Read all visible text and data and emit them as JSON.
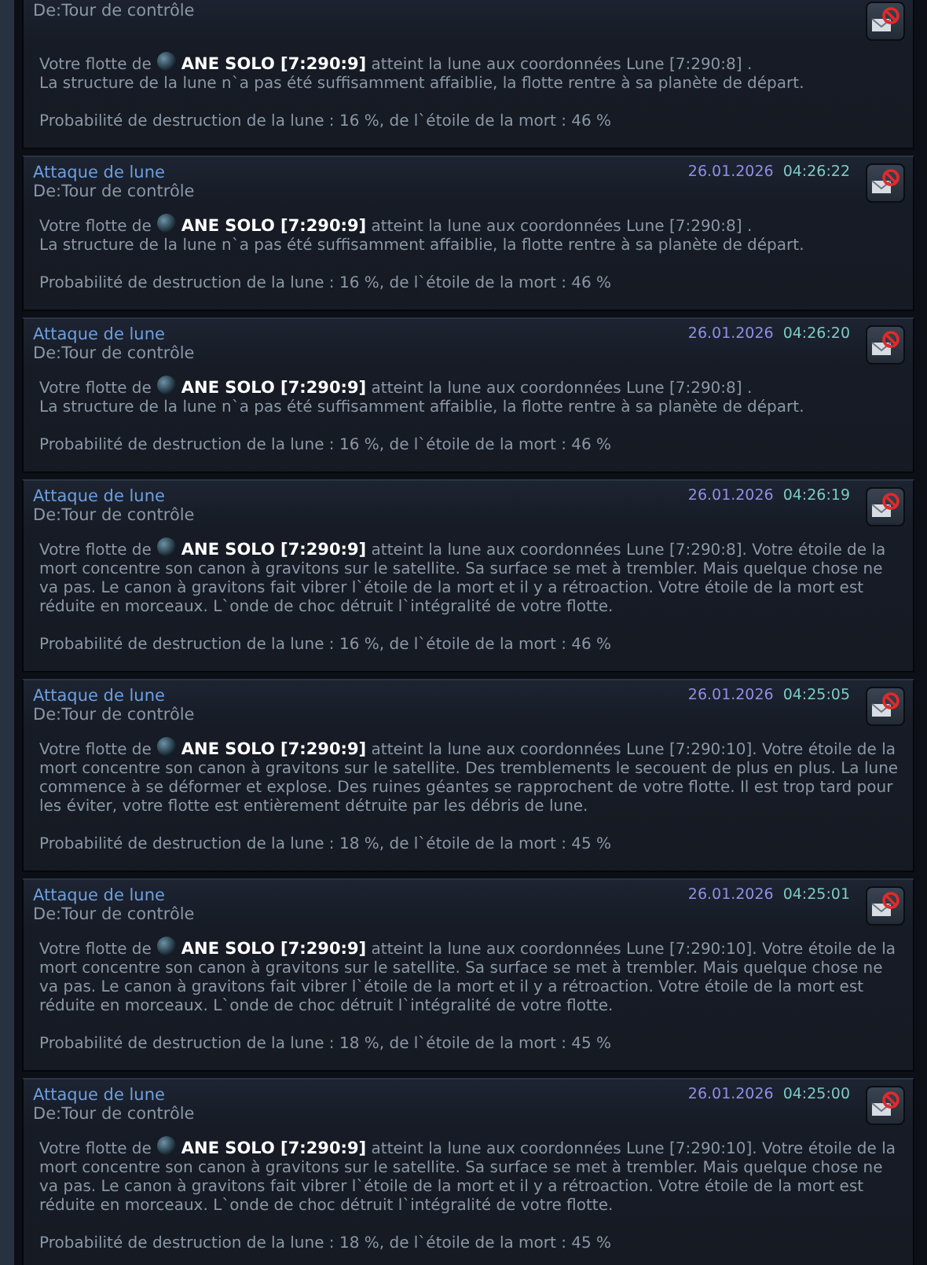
{
  "messages": [
    {
      "from": "De:Tour de contrôle",
      "fleet_prefix": "Votre flotte de",
      "player": "ANE SOLO [7:290:9]",
      "text": [
        "atteint la lune aux coordonnées Lune [7:290:8] .",
        "La structure de la lune n`a pas été suffisamment affaiblie, la flotte rentre à sa planète de départ."
      ],
      "probability": "Probabilité de destruction de la lune : 16 %, de l`étoile de la mort : 46 %"
    },
    {
      "title": "Attaque de lune",
      "from": "De:Tour de contrôle",
      "date": "26.01.2026",
      "time": "04:26:22",
      "fleet_prefix": "Votre flotte de",
      "player": "ANE SOLO [7:290:9]",
      "text": [
        "atteint la lune aux coordonnées Lune [7:290:8] .",
        "La structure de la lune n`a pas été suffisamment affaiblie, la flotte rentre à sa planète de départ."
      ],
      "probability": "Probabilité de destruction de la lune : 16 %, de l`étoile de la mort : 46 %"
    },
    {
      "title": "Attaque de lune",
      "from": "De:Tour de contrôle",
      "date": "26.01.2026",
      "time": "04:26:20",
      "fleet_prefix": "Votre flotte de",
      "player": "ANE SOLO [7:290:9]",
      "text": [
        "atteint la lune aux coordonnées Lune [7:290:8] .",
        "La structure de la lune n`a pas été suffisamment affaiblie, la flotte rentre à sa planète de départ."
      ],
      "probability": "Probabilité de destruction de la lune : 16 %, de l`étoile de la mort : 46 %"
    },
    {
      "title": "Attaque de lune",
      "from": "De:Tour de contrôle",
      "date": "26.01.2026",
      "time": "04:26:19",
      "fleet_prefix": "Votre flotte de",
      "player": "ANE SOLO [7:290:9]",
      "text": [
        "atteint la lune aux coordonnées Lune [7:290:8]. Votre étoile de la mort concentre son canon à gravitons sur le satellite. Sa surface se met à trembler. Mais quelque chose ne va pas. Le canon à gravitons fait vibrer l`étoile de la mort et il y a rétroaction. Votre étoile de la mort est réduite en morceaux. L`onde de choc détruit l`intégralité de votre flotte."
      ],
      "probability": "Probabilité de destruction de la lune : 16 %, de l`étoile de la mort : 46 %"
    },
    {
      "title": "Attaque de lune",
      "from": "De:Tour de contrôle",
      "date": "26.01.2026",
      "time": "04:25:05",
      "fleet_prefix": "Votre flotte de",
      "player": "ANE SOLO [7:290:9]",
      "text": [
        "atteint la lune aux coordonnées Lune [7:290:10]. Votre étoile de la mort concentre son canon à gravitons sur le satellite. Des tremblements le secouent de plus en plus. La lune commence à se déformer et explose. Des ruines géantes se rapprochent de votre flotte. Il est trop tard pour les éviter, votre flotte est entièrement détruite par les débris de lune."
      ],
      "probability": "Probabilité de destruction de la lune : 18 %, de l`étoile de la mort : 45 %"
    },
    {
      "title": "Attaque de lune",
      "from": "De:Tour de contrôle",
      "date": "26.01.2026",
      "time": "04:25:01",
      "fleet_prefix": "Votre flotte de",
      "player": "ANE SOLO [7:290:9]",
      "text": [
        "atteint la lune aux coordonnées Lune [7:290:10]. Votre étoile de la mort concentre son canon à gravitons sur le satellite. Sa surface se met à trembler. Mais quelque chose ne va pas. Le canon à gravitons fait vibrer l`étoile de la mort et il y a rétroaction. Votre étoile de la mort est réduite en morceaux. L`onde de choc détruit l`intégralité de votre flotte."
      ],
      "probability": "Probabilité de destruction de la lune : 18 %, de l`étoile de la mort : 45 %"
    },
    {
      "title": "Attaque de lune",
      "from": "De:Tour de contrôle",
      "date": "26.01.2026",
      "time": "04:25:00",
      "fleet_prefix": "Votre flotte de",
      "player": "ANE SOLO [7:290:9]",
      "text": [
        "atteint la lune aux coordonnées Lune [7:290:10]. Votre étoile de la mort concentre son canon à gravitons sur le satellite. Sa surface se met à trembler. Mais quelque chose ne va pas. Le canon à gravitons fait vibrer l`étoile de la mort et il y a rétroaction. Votre étoile de la mort est réduite en morceaux. L`onde de choc détruit l`intégralité de votre flotte."
      ],
      "probability": "Probabilité de destruction de la lune : 18 %, de l`étoile de la mort : 45 %"
    }
  ]
}
